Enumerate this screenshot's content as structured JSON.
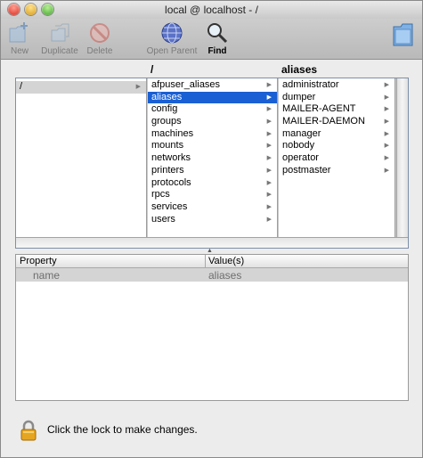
{
  "window": {
    "title": "local @ localhost - /"
  },
  "toolbar": {
    "new_label": "New",
    "duplicate_label": "Duplicate",
    "delete_label": "Delete",
    "open_parent_label": "Open Parent",
    "find_label": "Find"
  },
  "browser": {
    "col2_header": "/",
    "col3_header": "aliases",
    "col1_items": [
      "/"
    ],
    "col2_items": [
      "afpuser_aliases",
      "aliases",
      "config",
      "groups",
      "machines",
      "mounts",
      "networks",
      "printers",
      "protocols",
      "rpcs",
      "services",
      "users"
    ],
    "col3_items": [
      "administrator",
      "dumper",
      "MAILER-AGENT",
      "MAILER-DAEMON",
      "manager",
      "nobody",
      "operator",
      "postmaster"
    ],
    "selected_col2": "aliases"
  },
  "properties": {
    "col_property": "Property",
    "col_values": "Value(s)",
    "rows": [
      {
        "property": "name",
        "value": "aliases"
      }
    ]
  },
  "footer": {
    "lock_text": "Click the lock to make changes."
  },
  "icons": {
    "new": "new-folder-icon",
    "duplicate": "duplicate-icon",
    "delete": "delete-icon",
    "open_parent": "globe-icon",
    "find": "magnifier-icon",
    "toolbar_toggle": "folder-icon",
    "lock": "lock-icon"
  },
  "colors": {
    "selection": "#1a5fd3",
    "inactive_selection": "#d4d4d4"
  }
}
